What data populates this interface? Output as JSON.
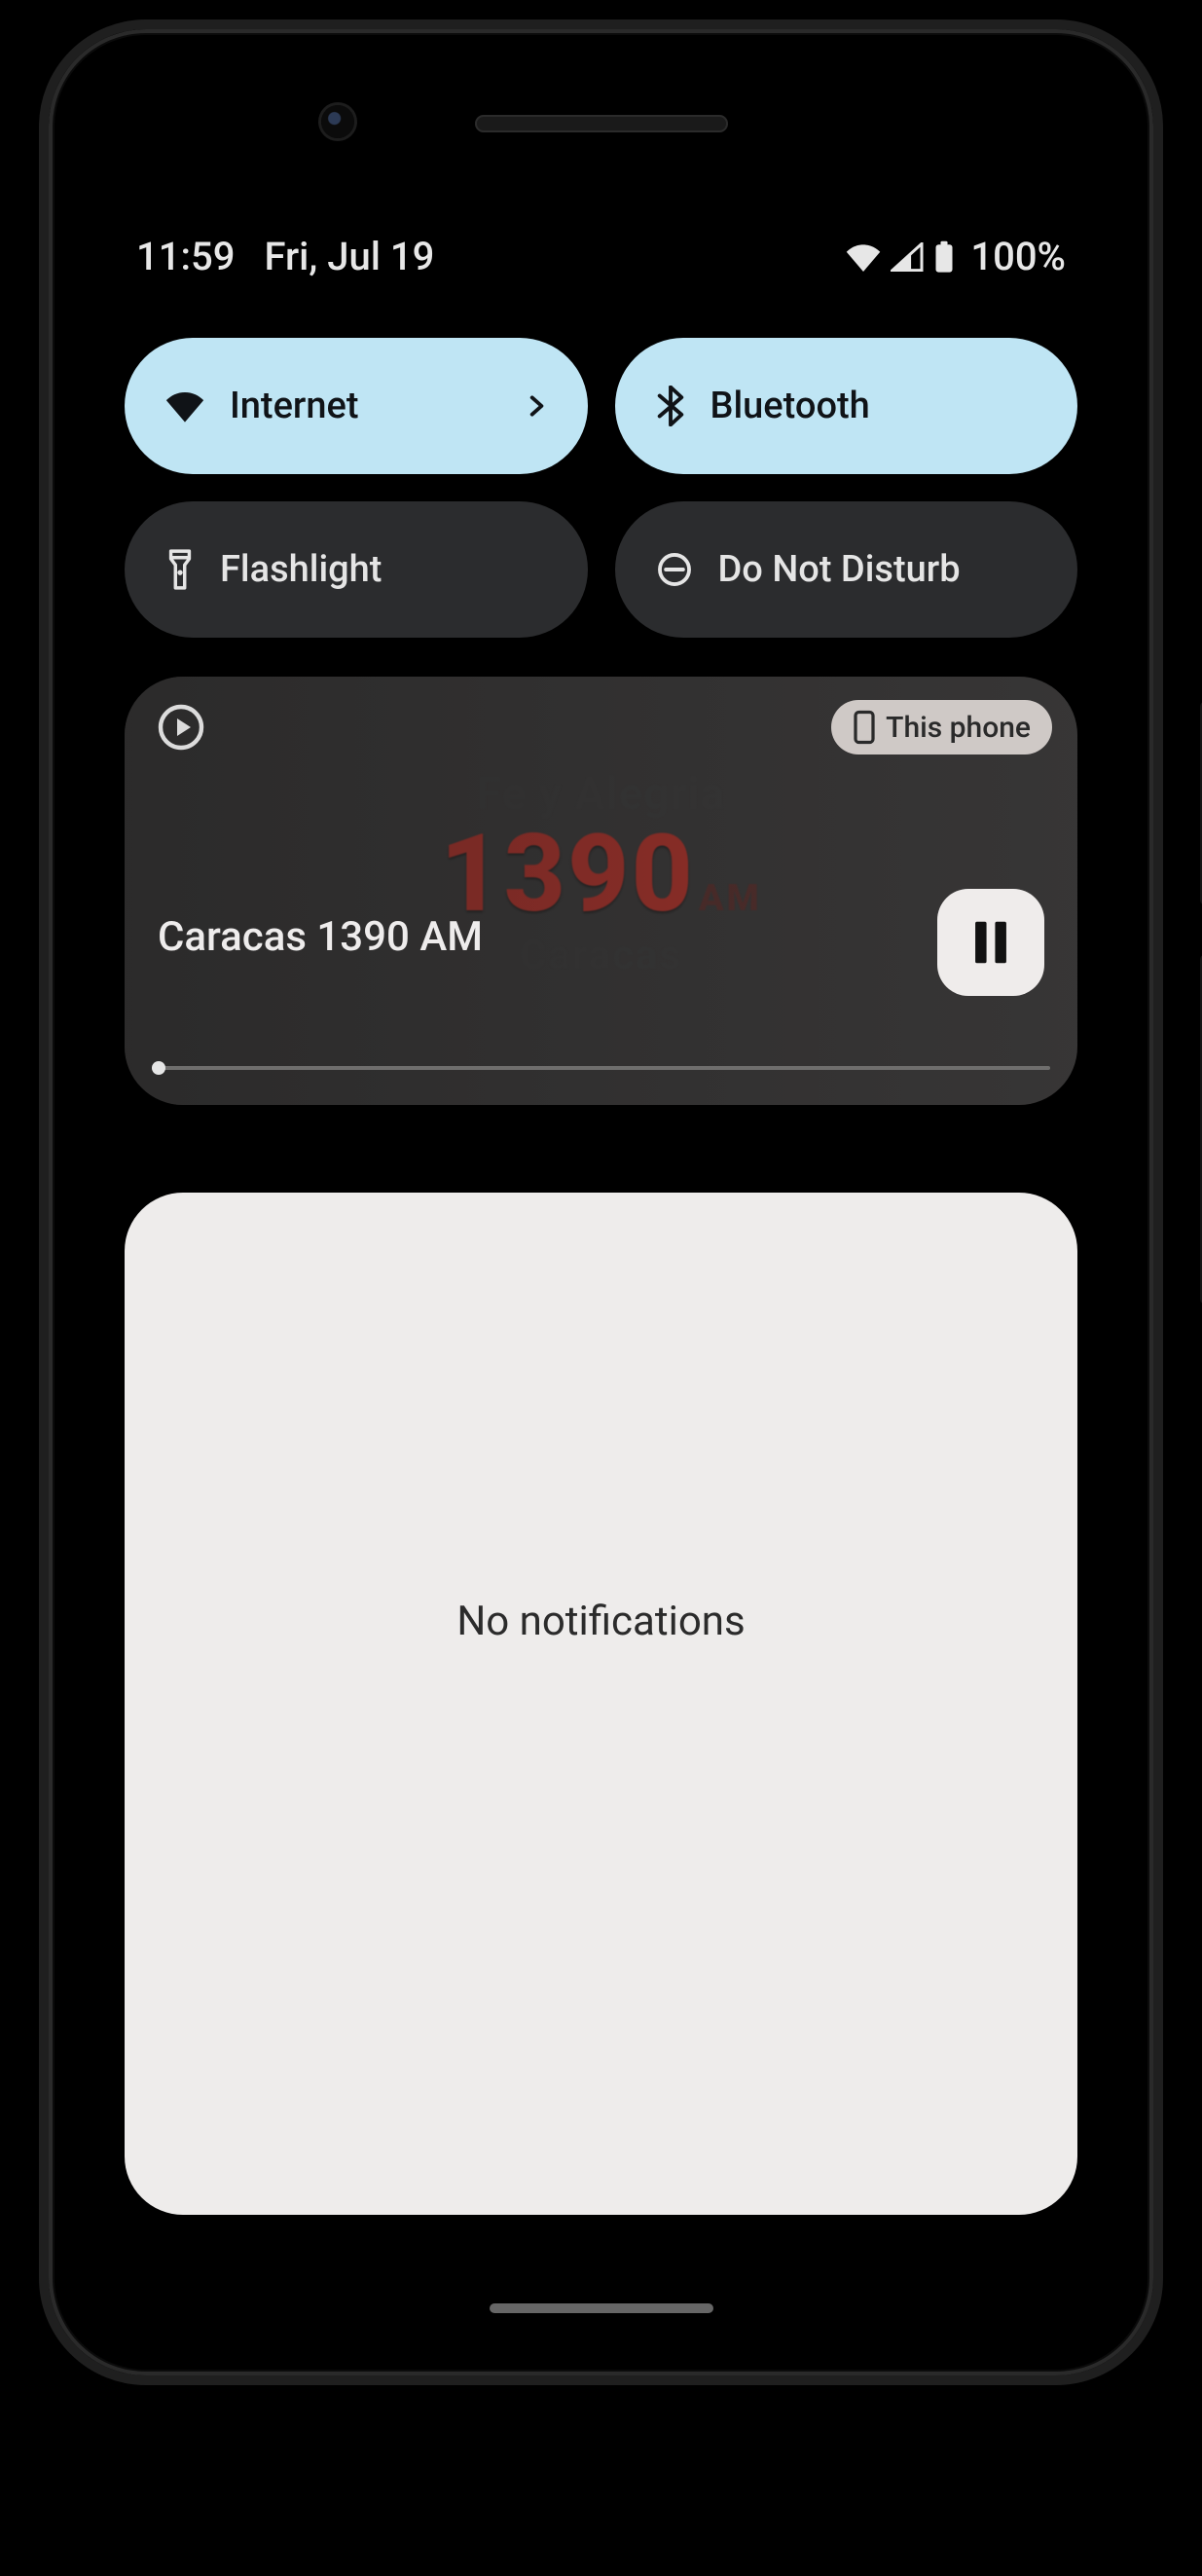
{
  "status": {
    "time": "11:59",
    "date": "Fri, Jul 19",
    "battery_pct": "100%"
  },
  "tiles": {
    "internet": {
      "label": "Internet"
    },
    "bluetooth": {
      "label": "Bluetooth"
    },
    "flashlight": {
      "label": "Flashlight"
    },
    "dnd": {
      "label": "Do Not Disturb"
    }
  },
  "media": {
    "output_label": "This phone",
    "title": "Caracas 1390 AM",
    "art": {
      "line_top": "Fe y Alegria",
      "main": "1390",
      "sub": "AM",
      "line_bottom": "Caracas"
    }
  },
  "notifications": {
    "empty_label": "No notifications"
  }
}
